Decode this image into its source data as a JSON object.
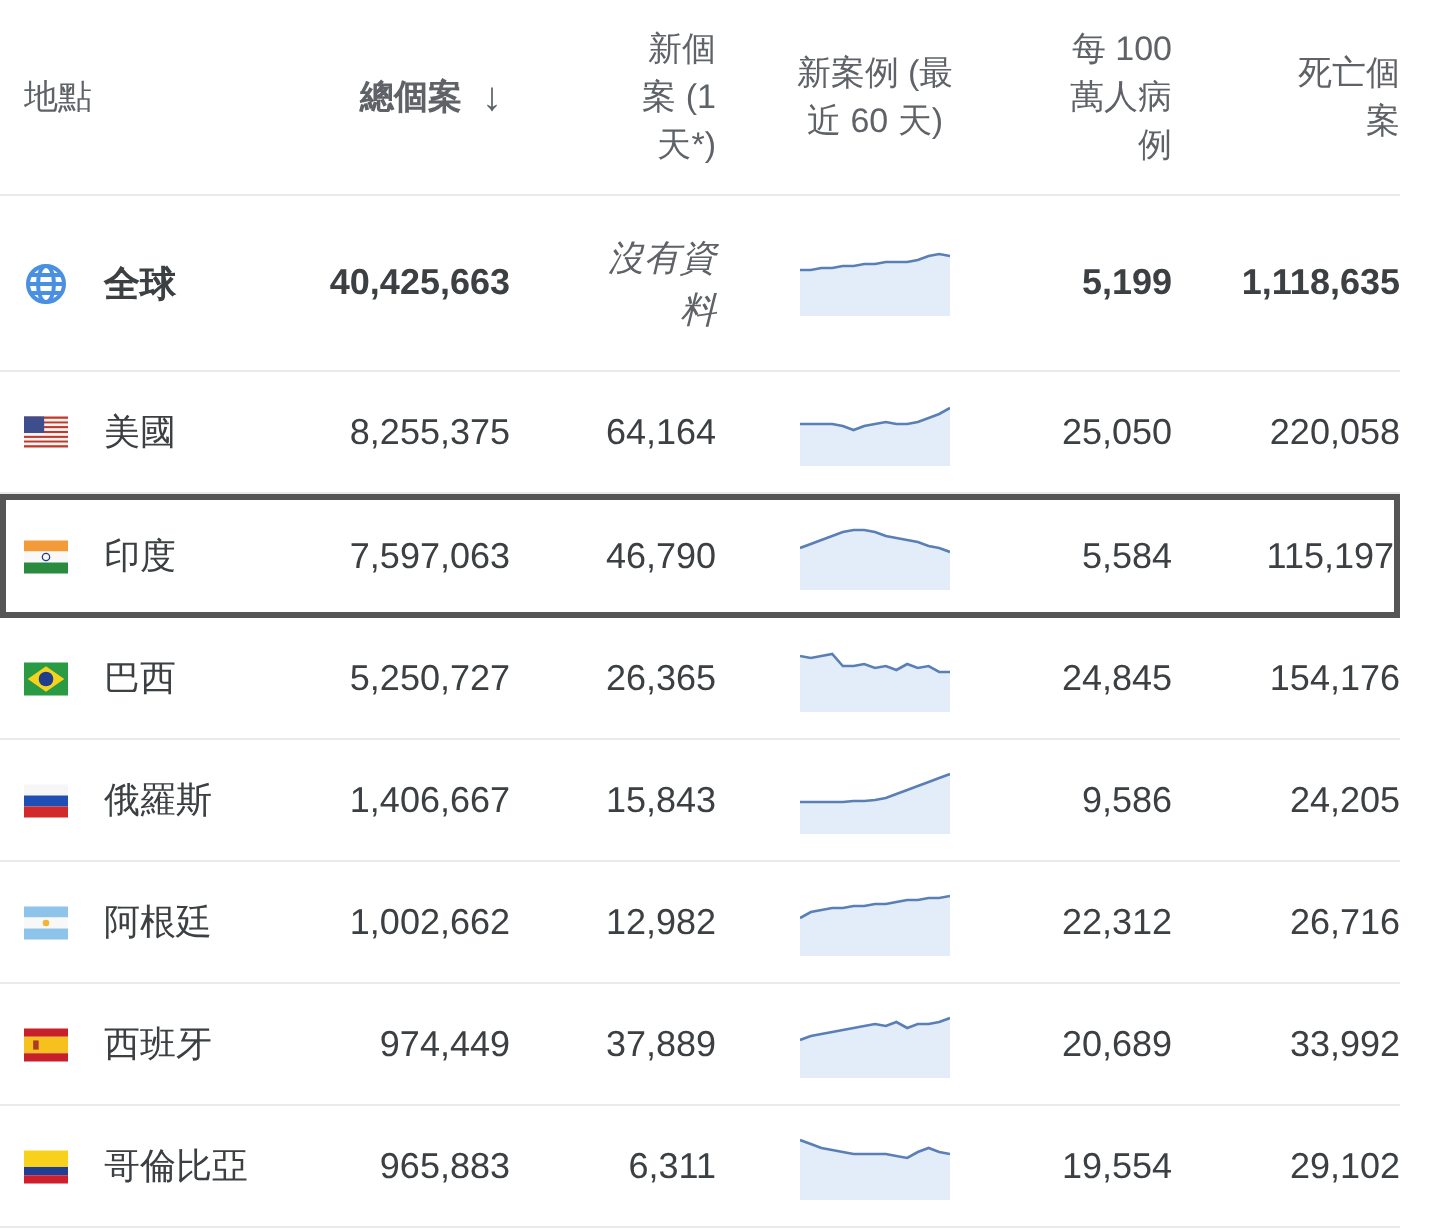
{
  "columns": [
    {
      "label": "地點",
      "sorted": false
    },
    {
      "label": "總個案",
      "sorted": true,
      "sort_arrow": "↓"
    },
    {
      "label": "新個案 (1 天*)",
      "sorted": false
    },
    {
      "label": "新案例 (最近 60 天)",
      "sorted": false
    },
    {
      "label": "每 100 萬人病例",
      "sorted": false
    },
    {
      "label": "死亡個案",
      "sorted": false
    }
  ],
  "rows": [
    {
      "kind": "total",
      "name": "全球",
      "total": "40,425,663",
      "new": "沒有資料",
      "new_missing": true,
      "per_million": "5,199",
      "deaths": "1,118,635",
      "selected": false
    },
    {
      "kind": "country",
      "name": "美國",
      "total": "8,255,375",
      "new": "64,164",
      "new_missing": false,
      "per_million": "25,050",
      "deaths": "220,058",
      "selected": false
    },
    {
      "kind": "country",
      "name": "印度",
      "total": "7,597,063",
      "new": "46,790",
      "new_missing": false,
      "per_million": "5,584",
      "deaths": "115,197",
      "selected": true
    },
    {
      "kind": "country",
      "name": "巴西",
      "total": "5,250,727",
      "new": "26,365",
      "new_missing": false,
      "per_million": "24,845",
      "deaths": "154,176",
      "selected": false
    },
    {
      "kind": "country",
      "name": "俄羅斯",
      "total": "1,406,667",
      "new": "15,843",
      "new_missing": false,
      "per_million": "9,586",
      "deaths": "24,205",
      "selected": false
    },
    {
      "kind": "country",
      "name": "阿根廷",
      "total": "1,002,662",
      "new": "12,982",
      "new_missing": false,
      "per_million": "22,312",
      "deaths": "26,716",
      "selected": false
    },
    {
      "kind": "country",
      "name": "西班牙",
      "total": "974,449",
      "new": "37,889",
      "new_missing": false,
      "per_million": "20,689",
      "deaths": "33,992",
      "selected": false
    },
    {
      "kind": "country",
      "name": "哥倫比亞",
      "total": "965,883",
      "new": "6,311",
      "new_missing": false,
      "per_million": "19,554",
      "deaths": "29,102",
      "selected": false
    }
  ]
}
